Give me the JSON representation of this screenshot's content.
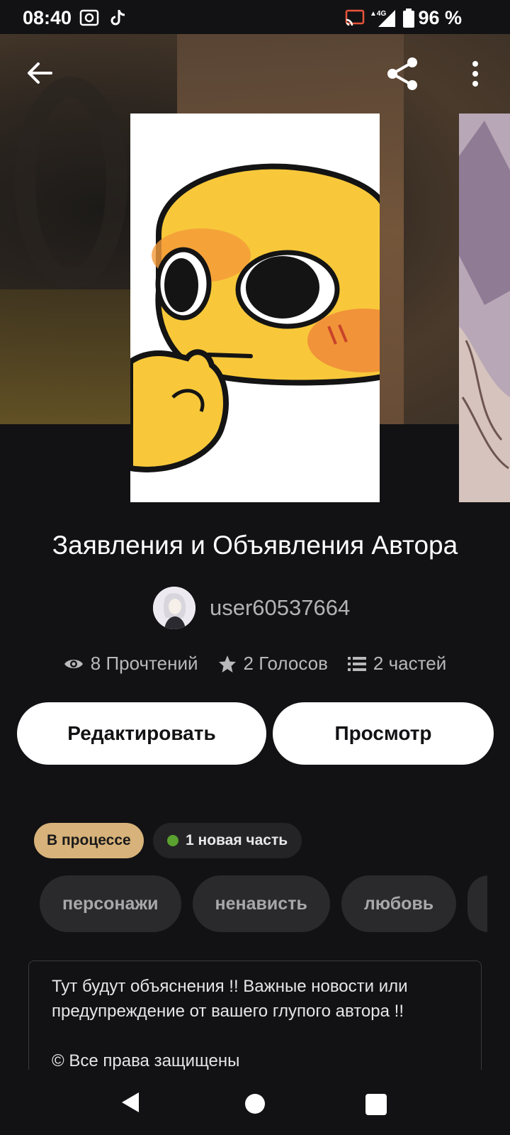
{
  "status_bar": {
    "time": "08:40",
    "battery": "96 %",
    "network": "4G",
    "icons": [
      "screenshot-icon",
      "tiktok-icon",
      "cast-icon",
      "signal-icon",
      "battery-icon"
    ]
  },
  "header": {
    "icons": [
      "back-arrow-icon",
      "share-icon",
      "more-vert-icon"
    ]
  },
  "story": {
    "title": "Заявления и Объявления Автора",
    "author": "user60537664",
    "stats": {
      "reads": "8 Прочтений",
      "votes": "2 Голосов",
      "parts": "2 частей"
    }
  },
  "actions": {
    "edit_label": "Редактировать",
    "view_label": "Просмотр"
  },
  "badges": {
    "status": "В процессе",
    "new_part": "1 новая часть"
  },
  "tags": [
    "персонажи",
    "ненависть",
    "любовь"
  ],
  "description": {
    "text": "Тут будут объяснения !! Важные новости или предупреждение от вашего глупого автора !!\n\n© Все права защищены"
  },
  "colors": {
    "background": "#121214",
    "status_badge": "#d7b27a",
    "new_dot": "#5aa12f",
    "tag_bg": "#2a2a2c"
  }
}
